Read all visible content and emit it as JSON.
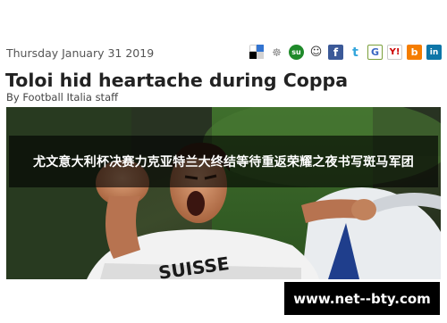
{
  "article": {
    "date": "Thursday January 31 2019",
    "title": "Toloi hid heartache during Coppa",
    "byline": "By Football Italia staff"
  },
  "share": {
    "icons": [
      {
        "name": "delicious-icon",
        "glyph": ""
      },
      {
        "name": "digg-icon",
        "glyph": "☸"
      },
      {
        "name": "stumbleupon-icon",
        "glyph": "su"
      },
      {
        "name": "reddit-icon",
        "glyph": "☺"
      },
      {
        "name": "facebook-icon",
        "glyph": "f"
      },
      {
        "name": "twitter-icon",
        "glyph": "t"
      },
      {
        "name": "google-icon",
        "glyph": "G"
      },
      {
        "name": "yahoo-icon",
        "glyph": "Y!"
      },
      {
        "name": "blogger-icon",
        "glyph": "b"
      },
      {
        "name": "linkedin-icon",
        "glyph": "in"
      }
    ]
  },
  "photo": {
    "overlay_caption": "尤文意大利杯决赛力克亚特兰大终结等待重返荣耀之夜书写斑马军团",
    "jersey_text": "SUISSE"
  },
  "watermark": {
    "text": "www.net--bty.com"
  },
  "colors": {
    "facebook": "#3b5998",
    "twitter": "#34a6dc",
    "stumbleupon": "#1f8a2a",
    "blogger": "#f57d00",
    "linkedin": "#0e76a8"
  }
}
